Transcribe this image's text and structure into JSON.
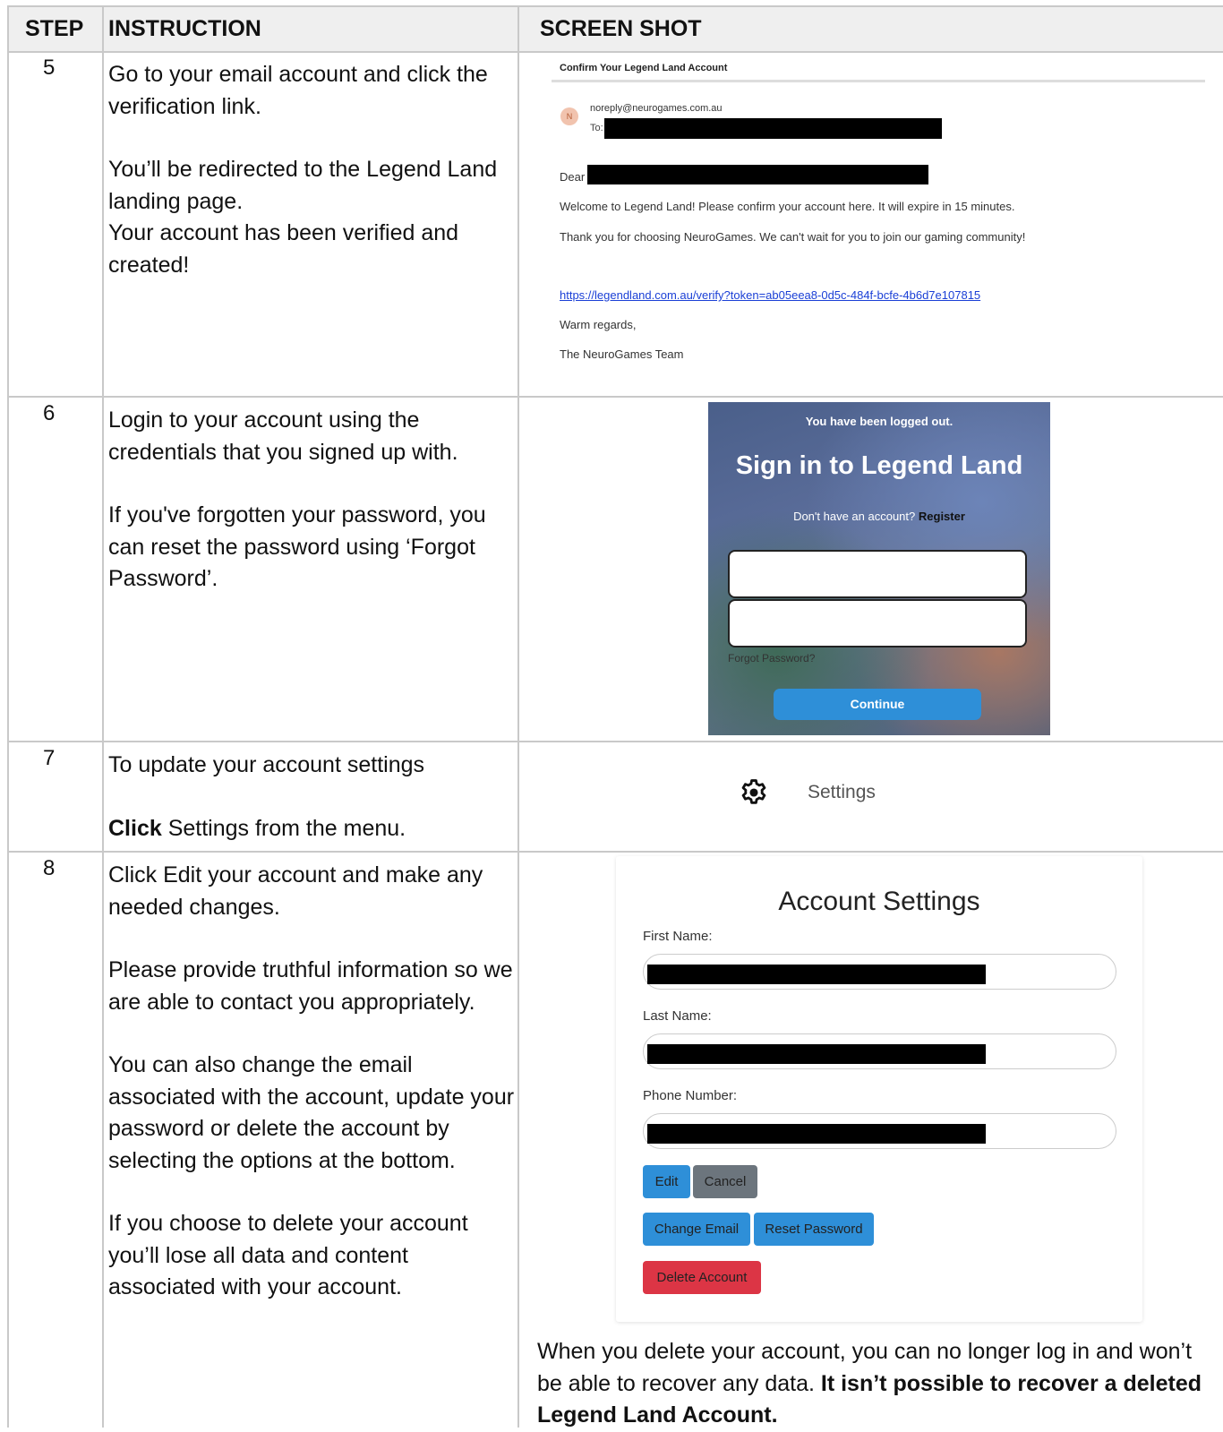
{
  "headers": {
    "step": "STEP",
    "instruction": "INSTRUCTION",
    "screenshot": "SCREEN SHOT"
  },
  "rows": [
    {
      "step": "5",
      "paragraphs": [
        "Go to your email account and click the verification link.",
        "You’ll be redirected to the Legend Land landing page.",
        "Your account has been verified and created!"
      ]
    },
    {
      "step": "6",
      "paragraphs": [
        "Login to your account using the credentials that you signed up with.",
        "If you've forgotten your password, you can reset the password using ‘Forgot Password’."
      ]
    },
    {
      "step": "7",
      "paragraphs": [
        "To update your account settings"
      ],
      "bold_prefix": "Click",
      "after_bold": " Settings from the menu."
    },
    {
      "step": "8",
      "paragraphs": [
        "Click Edit your account and make any needed changes.",
        "Please provide truthful information so we are able to contact you appropriately.",
        "You can also change the email associated with the account, update your password or delete the account by selecting the options at the bottom.",
        "If you choose to delete your account you’ll lose all data and content associated with your account."
      ]
    }
  ],
  "email": {
    "subject": "Confirm Your Legend Land Account",
    "avatar_letter": "N",
    "from": "noreply@neurogames.com.au",
    "to_label": "To:",
    "greeting": "Dear",
    "welcome": "Welcome to Legend Land! Please confirm your account here. It will expire in 15 minutes.",
    "thanks": "Thank you for choosing NeuroGames. We can't wait for you to join our gaming community!",
    "link": "https://legendland.com.au/verify?token=ab05eea8-0d5c-484f-bcfe-4b6d7e107815",
    "regards": "Warm regards,",
    "team": "The NeuroGames Team"
  },
  "login": {
    "logged_out": "You have been logged out.",
    "title": "Sign in to Legend Land",
    "no_account": "Don't have an account?",
    "register": "Register",
    "forgot": "Forgot Password?",
    "continue": "Continue"
  },
  "settings_menu": {
    "label": "Settings",
    "icon": "gear-icon"
  },
  "account": {
    "title": "Account Settings",
    "first_name": "First Name:",
    "last_name": "Last Name:",
    "phone": "Phone Number:",
    "edit": "Edit",
    "cancel": "Cancel",
    "change_email": "Change Email",
    "reset_password": "Reset Password",
    "delete_account": "Delete Account"
  },
  "delete_note": {
    "text": "When you delete your account, you can no longer log in and won’t be able to recover any data.",
    "bold": "It isn’t possible to recover a deleted Legend Land Account."
  },
  "colors": {
    "primary": "#2e8fd8",
    "secondary": "#6c757d",
    "danger": "#dc3545"
  }
}
